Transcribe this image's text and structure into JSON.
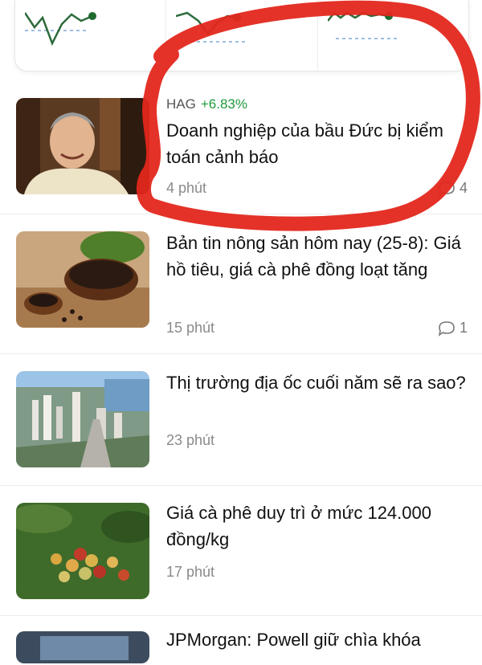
{
  "articles": [
    {
      "ticker": "HAG",
      "change": "+6.83%",
      "title": "Doanh nghiệp của bầu Đức bị kiểm toán cảnh báo",
      "time": "4 phút",
      "comments": "4",
      "thumb": "portrait-photo"
    },
    {
      "title": "Bản tin nông sản hôm nay (25-8): Giá hồ tiêu, giá cà phê đồng loạt tăng",
      "time": "15 phút",
      "comments": "1",
      "thumb": "pepper-photo"
    },
    {
      "title": "Thị trường địa ốc cuối năm sẽ ra sao?",
      "time": "23 phút",
      "thumb": "city-photo"
    },
    {
      "title": "Giá cà phê duy trì ở mức 124.000 đồng/kg",
      "time": "17 phút",
      "thumb": "coffee-photo"
    },
    {
      "title": "JPMorgan: Powell giữ chìa khóa",
      "thumb": "chart-photo"
    }
  ],
  "colors": {
    "positive": "#1e9a3a",
    "annotation": "#e3271c",
    "sparkline": "#2d6b3a"
  }
}
